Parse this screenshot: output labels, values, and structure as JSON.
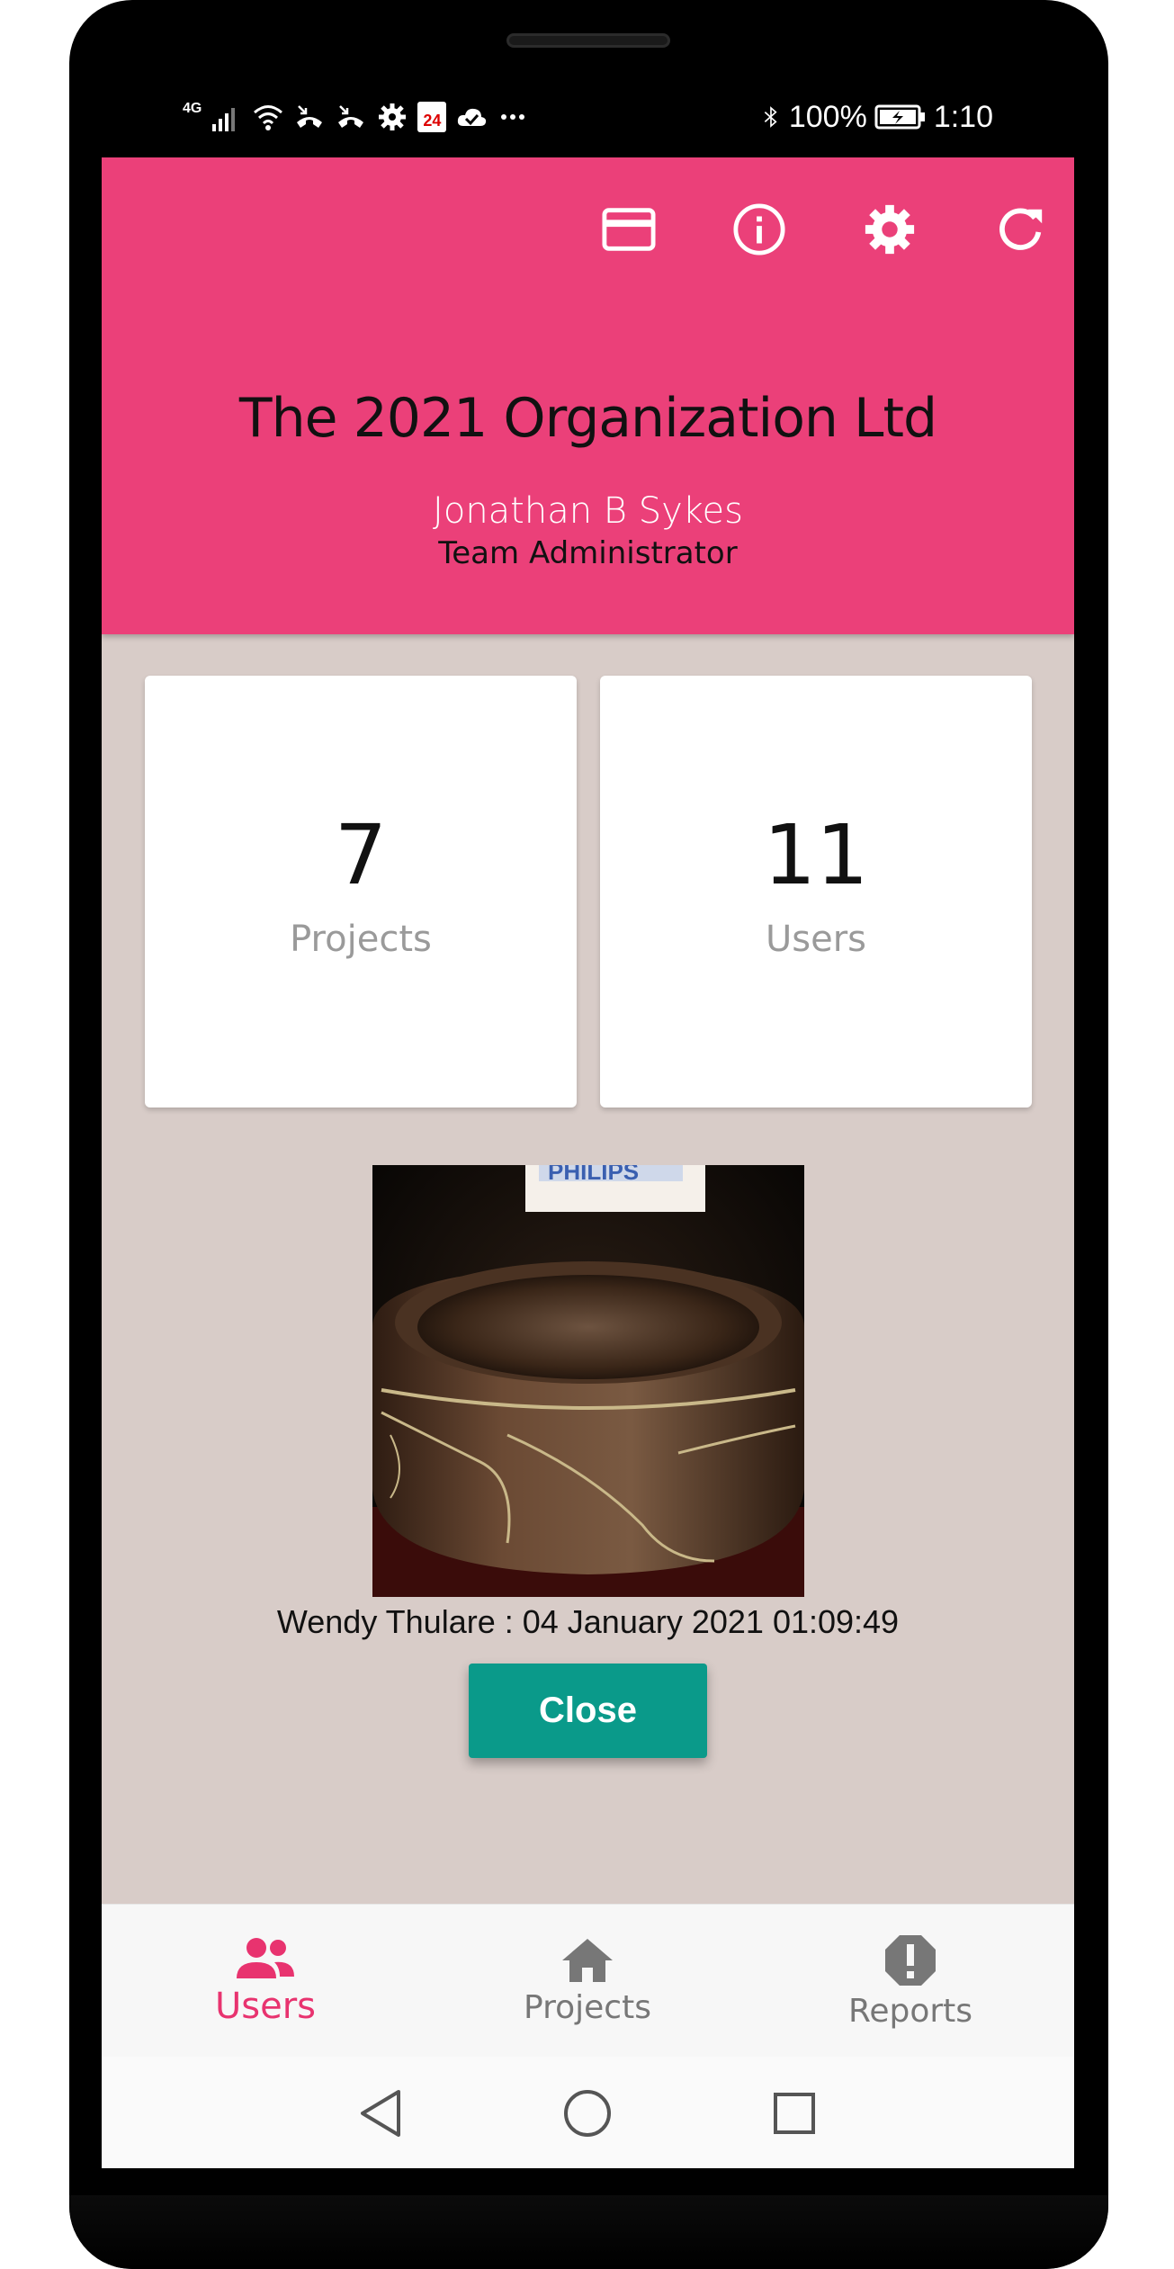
{
  "status_bar": {
    "network": "4G",
    "calendar_day": "24",
    "battery_text": "100%",
    "time": "1:10"
  },
  "header": {
    "organization": "The 2021 Organization Ltd",
    "user_name": "Jonathan B Sykes",
    "user_role": "Team Administrator",
    "toolbar_icons": [
      "card-icon",
      "info-icon",
      "settings-gear-icon",
      "refresh-icon"
    ]
  },
  "stats": {
    "projects": {
      "value": "7",
      "label": "Projects"
    },
    "users": {
      "value": "11",
      "label": "Users"
    }
  },
  "photo": {
    "caption": "Wendy Thulare : 04 January 2021 01:09:49",
    "box_label": "PHILIPS"
  },
  "close_button": {
    "label": "Close"
  },
  "bottom_nav": {
    "items": [
      {
        "label": "Users",
        "icon": "users-icon",
        "active": true
      },
      {
        "label": "Projects",
        "icon": "home-icon",
        "active": false
      },
      {
        "label": "Reports",
        "icon": "alert-icon",
        "active": false
      }
    ]
  },
  "colors": {
    "header": "#eb4079",
    "accent": "#e8336f",
    "button": "#0a9a8a",
    "background": "#d8ccc8"
  }
}
